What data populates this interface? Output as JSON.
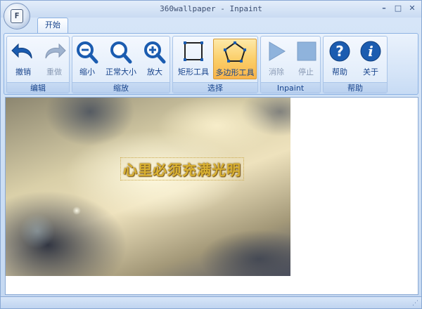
{
  "window": {
    "title": "360wallpaper - Inpaint",
    "app_icon_letter": "F",
    "controls": {
      "minimize": "–",
      "maximize": "□",
      "close": "✕"
    }
  },
  "tabs": [
    {
      "label": "开始"
    }
  ],
  "ribbon": {
    "groups": [
      {
        "label": "编辑",
        "buttons": [
          {
            "label": "撤销",
            "icon": "undo-icon",
            "enabled": true
          },
          {
            "label": "重做",
            "icon": "redo-icon",
            "enabled": false
          }
        ]
      },
      {
        "label": "缩放",
        "buttons": [
          {
            "label": "缩小",
            "icon": "zoom-out-icon",
            "enabled": true
          },
          {
            "label": "正常大小",
            "icon": "zoom-normal-icon",
            "enabled": true
          },
          {
            "label": "放大",
            "icon": "zoom-in-icon",
            "enabled": true
          }
        ]
      },
      {
        "label": "选择",
        "buttons": [
          {
            "label": "矩形工具",
            "icon": "rectangle-select-icon",
            "enabled": true
          },
          {
            "label": "多边形工具",
            "icon": "polygon-select-icon",
            "enabled": true,
            "active": true
          }
        ]
      },
      {
        "label": "Inpaint",
        "buttons": [
          {
            "label": "消除",
            "icon": "play-icon",
            "enabled": false
          },
          {
            "label": "停止",
            "icon": "stop-icon",
            "enabled": false
          }
        ]
      },
      {
        "label": "帮助",
        "buttons": [
          {
            "label": "帮助",
            "icon": "help-icon",
            "enabled": true
          },
          {
            "label": "关于",
            "icon": "info-icon",
            "enabled": true
          }
        ]
      }
    ]
  },
  "image": {
    "caption_text": "心里必须充满光明"
  },
  "colors": {
    "accent": "#15428b",
    "active_tool": "#fbcf6a",
    "icon_blue": "#1b5cb0"
  }
}
